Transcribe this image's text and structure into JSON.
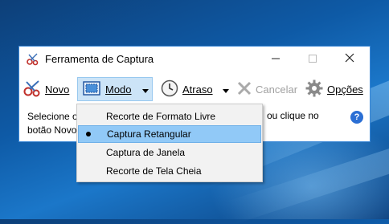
{
  "window": {
    "title": "Ferramenta de Captura",
    "controls": [
      "minimize",
      "maximize",
      "close"
    ]
  },
  "toolbar": {
    "novo": "Novo",
    "modo": "Modo",
    "atraso": "Atraso",
    "cancelar": "Cancelar",
    "opcoes": "Opções"
  },
  "hint": {
    "line1": "Selecione o",
    "line1_tail": "ou clique no",
    "line2": "botão Novo"
  },
  "mode_menu": {
    "items": [
      {
        "label": "Recorte de Formato Livre",
        "selected": false
      },
      {
        "label": "Captura Retangular",
        "selected": true
      },
      {
        "label": "Captura de Janela",
        "selected": false
      },
      {
        "label": "Recorte de Tela Cheia",
        "selected": false
      }
    ]
  },
  "colors": {
    "accent": "#3a87d6",
    "menu_highlight": "#91c9f7",
    "desktop": "#0e5aa6"
  },
  "icons": [
    "scissors-icon",
    "rectangle-mode-icon",
    "clock-icon",
    "cancel-x-icon",
    "gear-icon",
    "help-icon"
  ]
}
